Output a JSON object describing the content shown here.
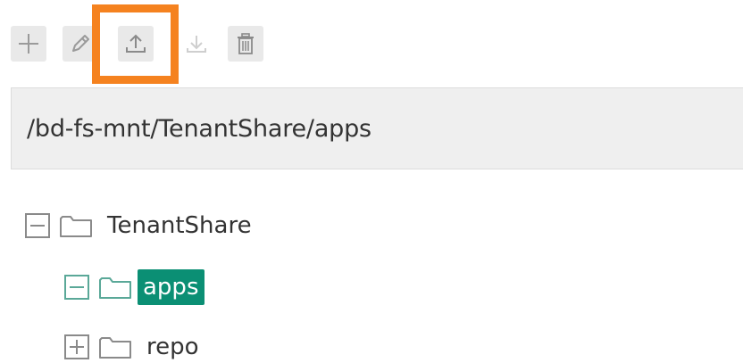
{
  "toolbar": {
    "buttons": [
      {
        "name": "add",
        "icon": "plus-icon",
        "enabled": true
      },
      {
        "name": "rename",
        "icon": "pencil-icon",
        "enabled": true
      },
      {
        "name": "upload",
        "icon": "upload-icon",
        "enabled": true,
        "highlighted": true
      },
      {
        "name": "download",
        "icon": "download-icon",
        "enabled": false
      },
      {
        "name": "delete",
        "icon": "trash-icon",
        "enabled": true
      }
    ],
    "highlight_color": "#f5821f"
  },
  "path": {
    "current": "/bd-fs-mnt/TenantShare/apps"
  },
  "tree": {
    "nodes": [
      {
        "label": "TenantShare",
        "expanded": true,
        "selected": false
      },
      {
        "label": "apps",
        "expanded": true,
        "selected": true
      },
      {
        "label": "repo",
        "expanded": false,
        "selected": false
      }
    ],
    "selected_color": "#0b8f74"
  }
}
